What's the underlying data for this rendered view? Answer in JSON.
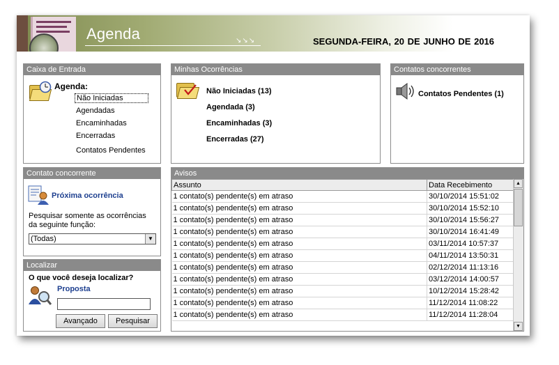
{
  "header": {
    "title": "Agenda",
    "arrows": "↘↘↘",
    "date": "SEGUNDA-FEIRA, 20  DE JUNHO DE  2016"
  },
  "inbox": {
    "title": "Caixa de Entrada",
    "heading": "Agenda:",
    "items": [
      "Não Iniciadas",
      "Agendadas",
      "Encaminhadas",
      "Encerradas",
      "Contatos Pendentes"
    ]
  },
  "occurrences": {
    "title": "Minhas Ocorrências",
    "items": [
      "Não Iniciadas  (13)",
      "Agendada  (3)",
      "Encaminhadas  (3)",
      "Encerradas  (27)"
    ]
  },
  "concurrent_contacts": {
    "title": "Contatos concorrentes",
    "item": "Contatos Pendentes (1)"
  },
  "concurrent_contact": {
    "title": "Contato concorrente",
    "next_label": "Próxima ocorrência",
    "filter_label": "Pesquisar somente as ocorrências da seguinte função:",
    "select_value": "(Todas)"
  },
  "search": {
    "title": "Localizar",
    "question": "O que você deseja localizar?",
    "option": "Proposta",
    "input_value": "",
    "advanced_button": "Avançado",
    "search_button": "Pesquisar"
  },
  "notices": {
    "title": "Avisos",
    "columns": [
      "Assunto",
      "Data Recebimento"
    ],
    "rows": [
      [
        "1 contato(s) pendente(s) em atraso",
        "30/10/2014 15:51:02"
      ],
      [
        "1 contato(s) pendente(s) em atraso",
        "30/10/2014 15:52:10"
      ],
      [
        "1 contato(s) pendente(s) em atraso",
        "30/10/2014 15:56:27"
      ],
      [
        "1 contato(s) pendente(s) em atraso",
        "30/10/2014 16:41:49"
      ],
      [
        "1 contato(s) pendente(s) em atraso",
        "03/11/2014 10:57:37"
      ],
      [
        "1 contato(s) pendente(s) em atraso",
        "04/11/2014 13:50:31"
      ],
      [
        "1 contato(s) pendente(s) em atraso",
        "02/12/2014 11:13:16"
      ],
      [
        "1 contato(s) pendente(s) em atraso",
        "03/12/2014 14:00:57"
      ],
      [
        "1 contato(s) pendente(s) em atraso",
        "10/12/2014 15:28:42"
      ],
      [
        "1 contato(s) pendente(s) em atraso",
        "11/12/2014 11:08:22"
      ],
      [
        "1 contato(s) pendente(s) em atraso",
        "11/12/2014 11:28:04"
      ]
    ]
  }
}
